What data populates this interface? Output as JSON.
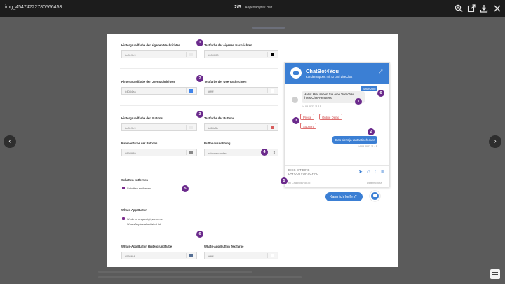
{
  "viewer": {
    "filename": "img_45474222780566453",
    "counter": "2/5",
    "counter_sub": "Angehängtes Bild",
    "icons": [
      "zoom-in-icon",
      "external-link-icon",
      "download-icon",
      "close-icon"
    ],
    "prev_icon": "‹",
    "next_icon": "›"
  },
  "settings": {
    "bg_own_label": "Hintergrundfarbe der eigenen Nachrichten",
    "bg_own_value": "#e9e9e9",
    "text_own_label": "Textfarbe der eigenen Nachrichten",
    "text_own_value": "#000000",
    "bg_user_label": "Hintergrundfarbe der Usernachrichten",
    "bg_user_value": "#4084ea",
    "text_user_label": "Textfarbe der Usernachrichten",
    "text_user_value": "#ffffff",
    "bg_btn_label": "Hintergrundfarbe der Buttons",
    "bg_btn_value": "#e9e9e9",
    "text_btn_label": "Textfarbe der Buttons",
    "text_btn_value": "#d65c5c",
    "border_btn_label": "Rahmenfarbe der Buttons",
    "border_btn_value": "#898989",
    "align_label": "Buttonausrichtung",
    "align_value": "nebeneinander",
    "shadow_heading": "Schatten entfernen",
    "shadow_checkbox": "Schatten entfernen",
    "wa_heading": "Whats-App Button",
    "wa_checkbox_1": "Wird nur angezeigt, wenn der",
    "wa_checkbox_2": "WhatsAppkanal aktiviert ist",
    "wa_bg_label": "Whats-App Button Hintergrundfarbe",
    "wa_bg_value": "#556f94",
    "wa_text_label": "Whats-App Button Textfarbe",
    "wa_text_value": "#ffffff"
  },
  "badges": {
    "b1": "1",
    "b2": "2",
    "b3": "3",
    "b4": "4",
    "b5": "5",
    "b6": "6",
    "w1": "1",
    "w2": "2",
    "w3": "3",
    "w5": "5",
    "w6": "6"
  },
  "widget": {
    "title": "ChatBot4You",
    "subtitle": "Kundensupport mit KI und LiveChat",
    "whatsapp_tag": "WhatsApp",
    "bot_message_1": "Hallo! Hier sehen Sie eine Vorschau",
    "bot_message_2": "Ihres Chat-Fensters",
    "bot_time": "14.08.2022 11:15",
    "quick_buttons": [
      "Preise",
      "Online Demo",
      "Support"
    ],
    "user_message": "Das sieht ja fantastisch aus!",
    "user_time": "14.08.2022 11:15",
    "input_line_1": "DIES IST EINE",
    "input_line_2": "LAYOUTVORSCHAU",
    "powered": "by ChatBot4You.io",
    "privacy": "Datenschutz",
    "help_text": "Kann ich helfen?"
  },
  "colors": {
    "accent": "#3b7fd4",
    "badge": "#6b2a8c",
    "btn_text": "#d65c5c",
    "swatch_bg_user": "#4084ea",
    "swatch_text_btn": "#d65c5c",
    "swatch_border_btn": "#898989",
    "swatch_wa_bg": "#556f94",
    "swatch_black": "#000000"
  }
}
